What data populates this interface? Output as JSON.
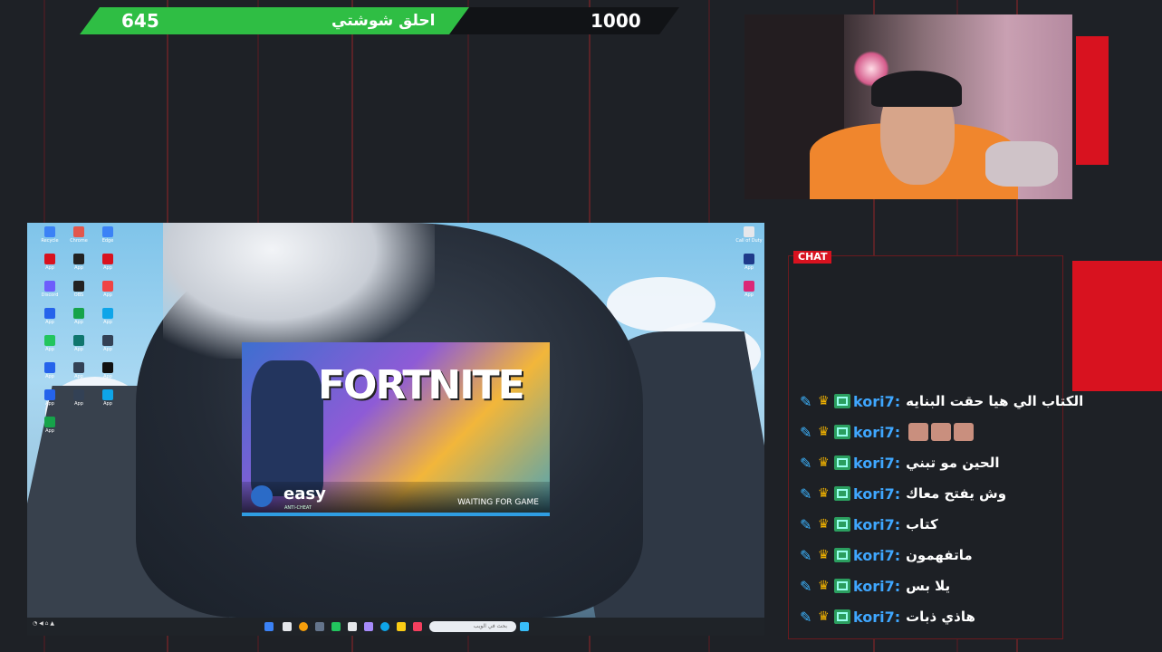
{
  "goal": {
    "current": "645",
    "title": "احلق شوشتي",
    "target": "1000"
  },
  "webcam": {
    "label": "webcam"
  },
  "screen": {
    "window_title": "FORTNITE",
    "anticheat_brand": "easy",
    "anticheat_sub": "ANTI-CHEAT",
    "status": "WAITING FOR GAME",
    "progress": 1.0,
    "search_placeholder": "بحث في الويب"
  },
  "chat": {
    "tag": "CHAT",
    "messages": [
      {
        "user": "kori7:",
        "text": "الكتاب الي هيا حقت البنايه"
      },
      {
        "user": "kori7:",
        "text": "",
        "emotes": 3
      },
      {
        "user": "kori7:",
        "text": "الحين مو تبني"
      },
      {
        "user": "kori7:",
        "text": "وش يفتح معاك"
      },
      {
        "user": "kori7:",
        "text": "كتاب"
      },
      {
        "user": "kori7:",
        "text": "ماتفهمون"
      },
      {
        "user": "kori7:",
        "text": "يلا بس"
      },
      {
        "user": "kori7:",
        "text": "هاذي ذبات"
      }
    ]
  },
  "colors": {
    "accent_red": "#d8121f",
    "goal_green": "#2fbe44",
    "chat_user": "#3fa7ff"
  }
}
